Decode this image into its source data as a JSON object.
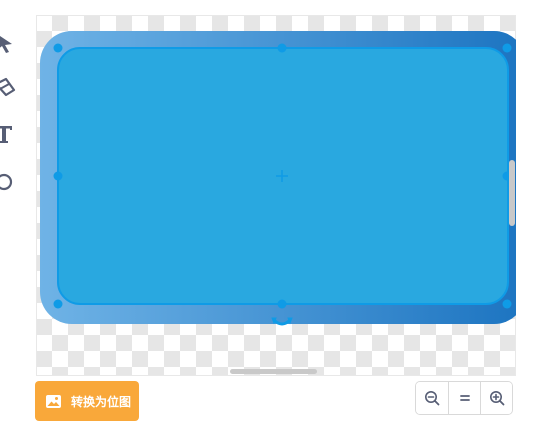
{
  "tools": [
    {
      "name": "select-tool",
      "icon": "arrow-cursor-icon"
    },
    {
      "name": "reshape-tool",
      "icon": "eraser-icon"
    },
    {
      "name": "text-tool",
      "icon": "text-icon"
    },
    {
      "name": "ellipse-tool",
      "icon": "circle-icon"
    }
  ],
  "shape": {
    "type": "rounded-rectangle",
    "fill": "#29a8e0",
    "outline_gradient": [
      "#6fb3e6",
      "#1c74c1"
    ],
    "selection_color": "#0f9be6"
  },
  "actions": {
    "convert_bitmap_label": "转换为位图",
    "convert_bitmap_icon": "image-icon",
    "convert_bitmap_color": "#f9a83a"
  },
  "zoom": {
    "zoom_out_icon": "zoom-out-icon",
    "reset_icon": "equals-icon",
    "zoom_in_icon": "zoom-in-icon"
  }
}
